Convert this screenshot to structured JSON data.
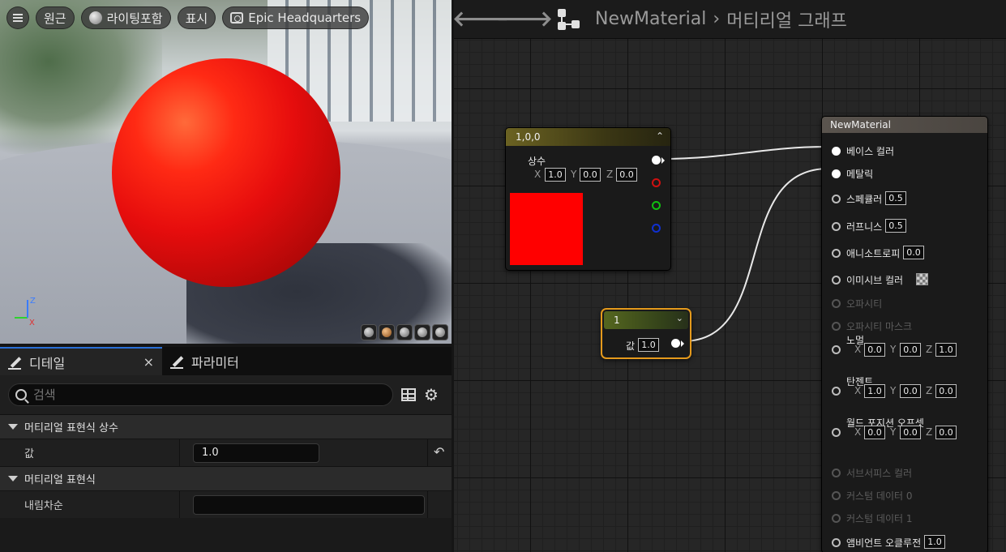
{
  "viewport": {
    "toolbar": {
      "menu_icon": "hamburger-icon",
      "perspective": "원근",
      "lighting": "라이팅포함",
      "show": "표시",
      "environment": "Epic Headquarters"
    },
    "axis_labels": {
      "z": "Z",
      "x": "X"
    },
    "preview_shapes": [
      "cylinder",
      "sphere",
      "plane",
      "cube",
      "custom-mesh"
    ]
  },
  "details": {
    "tabs": [
      {
        "label": "디테일",
        "icon": "pencil-icon",
        "active": true
      },
      {
        "label": "파라미터",
        "icon": "pencil-icon",
        "active": false
      }
    ],
    "close_glyph": "×",
    "search_placeholder": "검색",
    "categories": [
      {
        "title": "머티리얼 표현식 상수",
        "rows": [
          {
            "label": "값",
            "value": "1.0"
          }
        ]
      },
      {
        "title": "머티리얼 표현식",
        "rows": [
          {
            "label": "내림차순",
            "value": ""
          }
        ]
      }
    ]
  },
  "graph": {
    "breadcrumb": {
      "asset": "NewMaterial",
      "separator": "›",
      "page": "머티리얼 그래프"
    },
    "nodes": {
      "constant3": {
        "title": "1,0,0",
        "output_label": "상수",
        "x": "1.0",
        "y": "0.0",
        "z": "0.0",
        "axis": {
          "x": "X",
          "y": "Y",
          "z": "Z"
        },
        "color": "#ff0000",
        "header_color": "#6b6222"
      },
      "constant": {
        "title": "1",
        "input_label": "값",
        "value": "1.0",
        "header_color": "#55661f",
        "selection_color": "#e59a1c"
      },
      "result": {
        "title": "NewMaterial",
        "pins": [
          {
            "label": "베이스 컬러",
            "value": "",
            "active": true,
            "connected": true
          },
          {
            "label": "메탈릭",
            "value": "",
            "active": true,
            "connected": true
          },
          {
            "label": "스페큘러",
            "value": "0.5",
            "active": true
          },
          {
            "label": "러프니스",
            "value": "0.5",
            "active": true
          },
          {
            "label": "애니소트로피",
            "value": "0.0",
            "active": true
          },
          {
            "label": "이미시브 컬러",
            "value": "",
            "active": true,
            "checker": true
          },
          {
            "label": "오파시티",
            "value": "",
            "active": false
          },
          {
            "label": "오파시티 마스크",
            "value": "",
            "active": false
          },
          {
            "label": "노멀",
            "active": true,
            "vec": {
              "x": "0.0",
              "y": "0.0",
              "z": "1.0"
            }
          },
          {
            "label": "탄젠트",
            "active": true,
            "vec": {
              "x": "1.0",
              "y": "0.0",
              "z": "0.0"
            }
          },
          {
            "label": "월드 포지션 오프셋",
            "active": true,
            "vec": {
              "x": "0.0",
              "y": "0.0",
              "z": "0.0"
            }
          },
          {
            "label": "서브서피스 컬러",
            "value": "",
            "active": false
          },
          {
            "label": "커스텀 데이터 0",
            "value": "",
            "active": false
          },
          {
            "label": "커스텀 데이터 1",
            "value": "",
            "active": false
          },
          {
            "label": "앰비언트 오클루전",
            "value": "1.0",
            "active": true
          }
        ]
      }
    },
    "colors": {
      "accent": "#2a6fd6",
      "wire": "#e8e8e8",
      "pin_red": "#d01010",
      "pin_green": "#10c010",
      "pin_blue": "#1030d0"
    }
  }
}
